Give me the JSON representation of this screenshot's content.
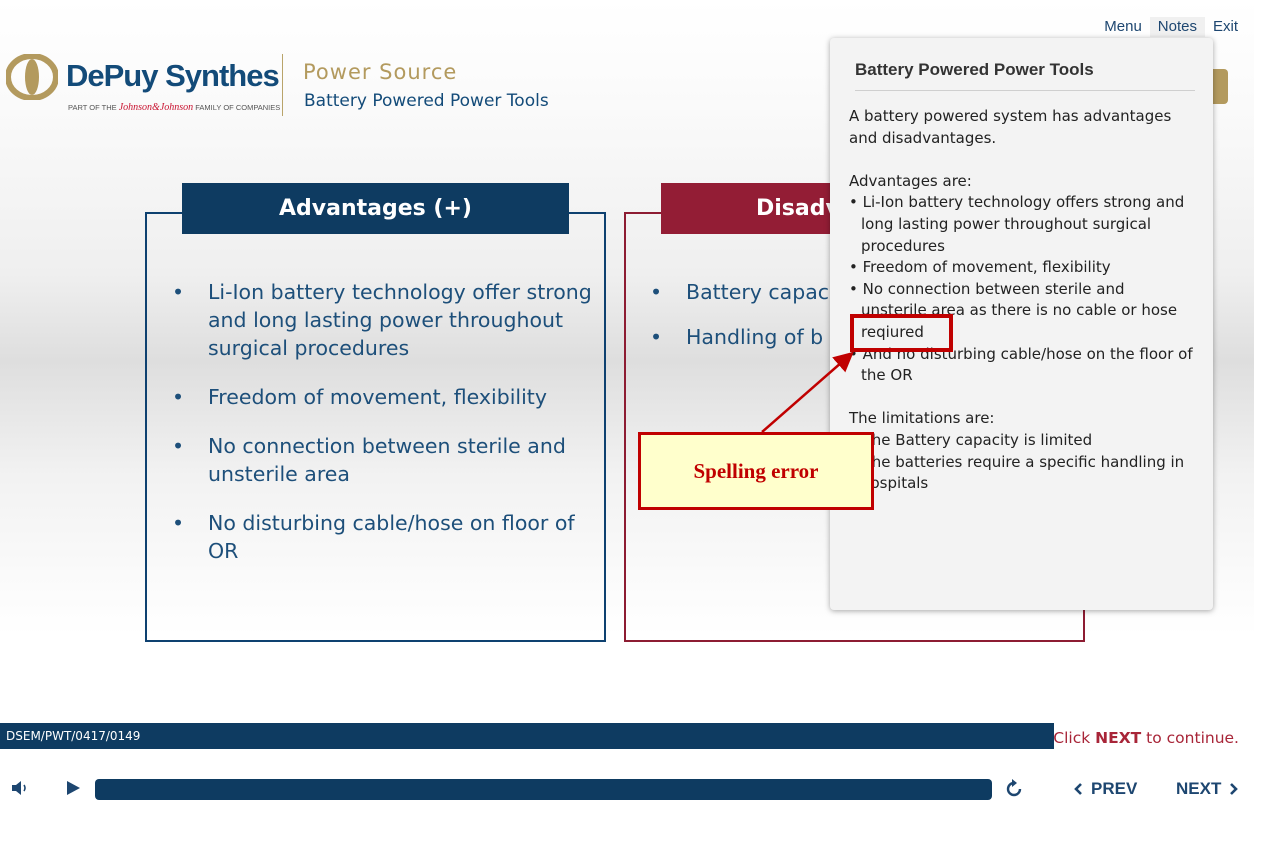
{
  "topnav": {
    "menu": "Menu",
    "notes": "Notes",
    "exit": "Exit"
  },
  "brand": {
    "name": "DePuy Synthes",
    "tagline_pre": "PART OF THE ",
    "tagline_jj": "Johnson&Johnson",
    "tagline_post": " FAMILY OF COMPANIES",
    "module_title": "Power Source",
    "module_subtitle": "Battery Powered Power Tools"
  },
  "colors": {
    "navy": "#0e3b61",
    "crimson": "#931d35",
    "gold": "#b39a5e",
    "callout_red": "#c00000"
  },
  "slide": {
    "advantages": {
      "heading": "Advantages (+)",
      "items": [
        "Li-Ion battery technology offer strong and long lasting power throughout surgical procedures",
        "Freedom of movement, flexibility",
        "No connection between sterile and unsterile area",
        "No disturbing cable/hose on floor of OR"
      ]
    },
    "disadvantages": {
      "heading_visible": "Disadv",
      "items_visible": [
        "Battery capaci",
        "Handling of b"
      ]
    }
  },
  "notes_panel": {
    "title": "Battery Powered Power Tools",
    "intro": "A battery powered system has advantages and disadvantages.",
    "adv_heading": "Advantages are:",
    "adv_items": [
      "• Li-Ion battery technology offers strong and long lasting power throughout surgical procedures",
      "• Freedom of movement, flexibility",
      "• No connection between sterile and unsterile area as there is no cable or hose reqiured",
      "• And no disturbing cable/hose on the floor of the OR"
    ],
    "lim_heading": "The limitations are:",
    "lim_items": [
      "• The Battery capacity is limited",
      "• The batteries require a specific handling in hospitals"
    ]
  },
  "annotation": {
    "callout_text": "Spelling error",
    "highlighted_word": "reqiured"
  },
  "footer": {
    "code": "DSEM/PWT/0417/0149",
    "continue_pre": "Click ",
    "continue_next": "NEXT",
    "continue_post": " to continue."
  },
  "player": {
    "prev_label": "PREV",
    "next_label": "NEXT"
  }
}
